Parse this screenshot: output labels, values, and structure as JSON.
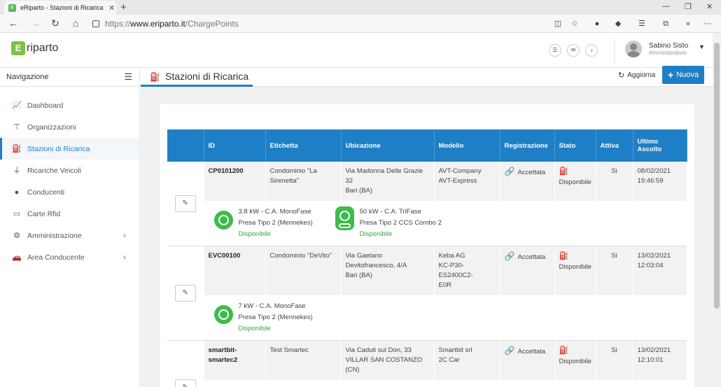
{
  "browser": {
    "tab_title": "eRiparto - Stazioni di Ricarica",
    "url_scheme": "https://",
    "url_host": "www.eriparto.it",
    "url_path": "/ChargePoints"
  },
  "header": {
    "logo_mark": "E",
    "logo_text": "riparto",
    "user_name": "Sabino Sisto",
    "user_role": "Amministratore"
  },
  "sidebar": {
    "title": "Navigazione",
    "items": [
      {
        "label": "Dashboard",
        "icon": "chart-line-icon"
      },
      {
        "label": "Organizzazioni",
        "icon": "sitemap-icon"
      },
      {
        "label": "Stazioni di Ricarica",
        "icon": "charging-station-icon"
      },
      {
        "label": "Ricariche Veicoli",
        "icon": "plug-icon"
      },
      {
        "label": "Conducenti",
        "icon": "user-icon"
      },
      {
        "label": "Carte Rfid",
        "icon": "card-icon"
      },
      {
        "label": "Amministrazione",
        "icon": "users-cog-icon"
      },
      {
        "label": "Area Conducente",
        "icon": "car-icon"
      }
    ]
  },
  "page": {
    "title": "Stazioni di Ricarica",
    "refresh_label": "Aggiorna",
    "new_label": "Nuova"
  },
  "table": {
    "headers": [
      "ID",
      "Etichetta",
      "Ubicazione",
      "Modello",
      "Registrazione",
      "Stato",
      "Attiva",
      "Ultimo Ascolto"
    ],
    "rows": [
      {
        "id": "CP0101200",
        "label": "Condominio \"La Sirenetta\"",
        "location": [
          "Via Madonna Delle Grazie",
          "32",
          "Bari (BA)"
        ],
        "model": [
          "AVT-Company",
          "AVT-Express"
        ],
        "registration": "Accettata",
        "status": "Disponibile",
        "active": "Si",
        "last_seen": [
          "08/02/2021",
          "19:46:59"
        ],
        "connectors": [
          {
            "power": "3.8 kW - C.A. MonoFase",
            "type": "Presa Tipo 2 (Mennekes)",
            "status": "Disponibile"
          },
          {
            "power": "50 kW - C.A. TriFase",
            "type": "Presa Tipo 2 CCS Combo 2",
            "status": "Disponibile"
          }
        ]
      },
      {
        "id": "EVC00100",
        "label": "Condominio \"DeVito\"",
        "location": [
          "Via Gaetano",
          "Devitofrancesco, 4/A",
          "Bari (BA)"
        ],
        "model": [
          "Keba AG",
          "KC-P30-ES2400C2-",
          "E0R"
        ],
        "registration": "Accettata",
        "status": "Disponibile",
        "active": "Si",
        "last_seen": [
          "13/02/2021",
          "12:03:04"
        ],
        "connectors": [
          {
            "power": "7 kW - C.A. MonoFase",
            "type": "Presa Tipo 2 (Mennekes)",
            "status": "Disponibile"
          }
        ]
      },
      {
        "id": "smartbit-smartec2",
        "label": "Test Smartec",
        "location": [
          "Via Caduti sul Don, 33",
          "VILLAR SAN COSTANZO (CN)"
        ],
        "model": [
          "Smartbit srl",
          "2C Car"
        ],
        "registration": "Accettata",
        "status": "Disponibile",
        "active": "Si",
        "last_seen": [
          "13/02/2021",
          "12:10:01"
        ]
      }
    ]
  },
  "colors": {
    "primary": "#1f7fc6",
    "success": "#2eaa3b",
    "logo": "#7cc244"
  }
}
